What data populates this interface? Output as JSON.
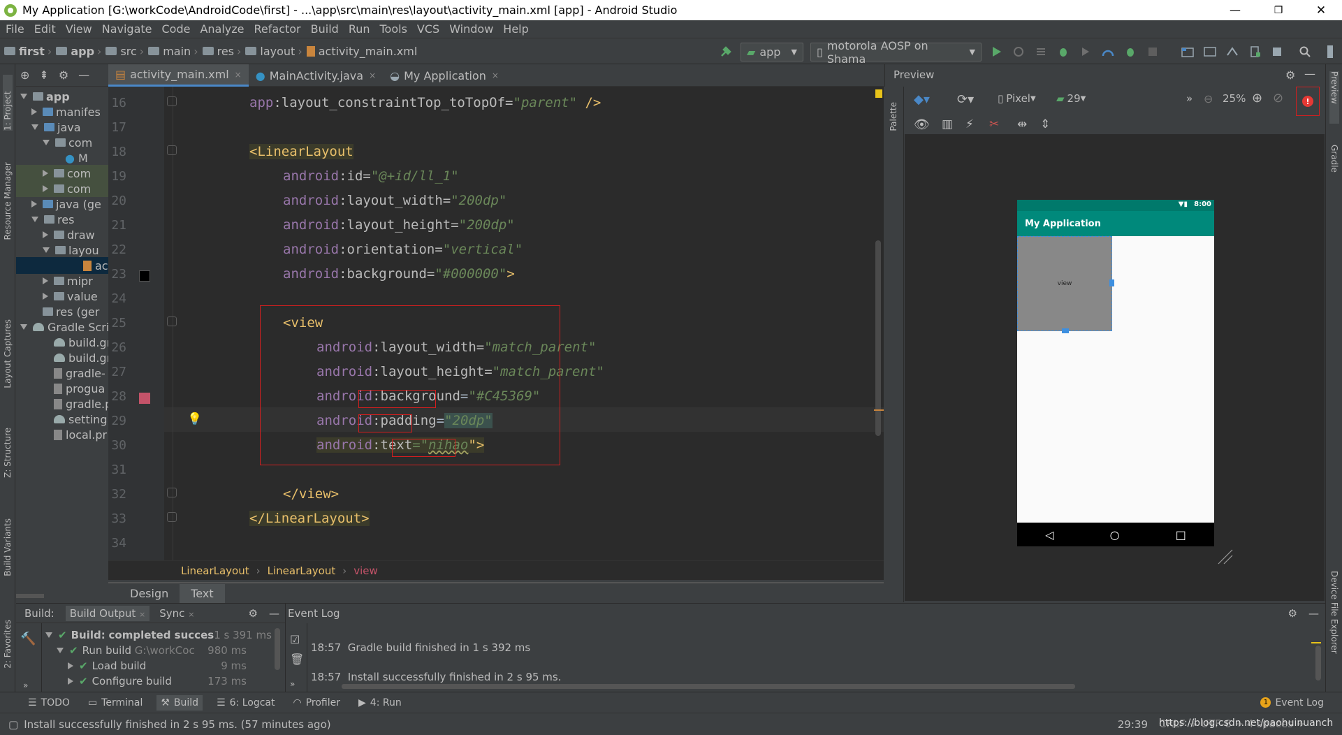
{
  "window": {
    "title": "My Application [G:\\workCode\\AndroidCode\\first] - ...\\app\\src\\main\\res\\layout\\activity_main.xml [app] - Android Studio",
    "minimize": "—",
    "restore": "❐",
    "close": "✕"
  },
  "menu": [
    "File",
    "Edit",
    "View",
    "Navigate",
    "Code",
    "Analyze",
    "Refactor",
    "Build",
    "Run",
    "Tools",
    "VCS",
    "Window",
    "Help"
  ],
  "breadcrumb": {
    "first": "first",
    "app": "app",
    "src": "src",
    "main": "main",
    "res": "res",
    "layout": "layout",
    "file": "activity_main.xml"
  },
  "toolbar": {
    "config": "app",
    "device": "motorola AOSP on Shama"
  },
  "left_stripe": {
    "project": "1: Project",
    "resource_manager": "Resource Manager",
    "layout_captures": "Layout Captures",
    "structure": "Z: Structure",
    "build_variants": "Build Variants",
    "favorites": "2: Favorites"
  },
  "right_stripe": {
    "preview": "Preview",
    "gradle": "Gradle",
    "device_file_explorer": "Device File Explorer"
  },
  "project_tree": [
    "app",
    "manifes",
    "java",
    "com",
    "M",
    "com",
    "com",
    "java (ge",
    "res",
    "draw",
    "layou",
    "ac",
    "mipr",
    "value",
    "res (ger",
    "Gradle Scri",
    "build.gr",
    "build.gr",
    "gradle-",
    "progua",
    "gradle.p",
    "setting:",
    "local.pr"
  ],
  "editor_tabs": [
    {
      "label": "activity_main.xml"
    },
    {
      "label": "MainActivity.java"
    },
    {
      "label": "My Application"
    }
  ],
  "tab_close": "×",
  "line_numbers": [
    "16",
    "17",
    "18",
    "19",
    "20",
    "21",
    "22",
    "23",
    "24",
    "25",
    "26",
    "27",
    "28",
    "29",
    "30",
    "31",
    "32",
    "33",
    "34"
  ],
  "code": {
    "l16_ns": "app",
    "l16_attr": ":layout_constraintTop_toTopOf=",
    "l16_val": "\"parent\"",
    "l16_end": " />",
    "l18_tag": "<LinearLayout",
    "android": "android",
    "l19_attr": ":id=",
    "l19_val": "\"@+id/ll_1\"",
    "l20_attr": ":layout_width=",
    "l20_val": "\"200dp\"",
    "l21_attr": ":layout_height=",
    "l21_val": "\"200dp\"",
    "l22_attr": ":orientation=",
    "l22_val": "\"vertical\"",
    "l23_attr": ":background=",
    "l23_val": "\"#000000\"",
    "l23_end": ">",
    "l25_tag": "<view",
    "l26_attr": ":layout_width=",
    "l26_val": "\"match_parent\"",
    "l27_attr": ":layout_height=",
    "l27_val": "\"match_parent\"",
    "l28_colon": ":",
    "l28_attr": "background",
    "l28_eq": "=",
    "l28_val": "\"#C45369\"",
    "l29_colon": ":",
    "l29_attr": "padding",
    "l29_eq": "=",
    "l29_val": "\"20dp\"",
    "l30_attr": ":text",
    "l30_eq": "=\"",
    "l30_val": "nihao",
    "l30_end": "\">",
    "l32_tag": "</view>",
    "l33_tag": "</LinearLayout>"
  },
  "editor_breadcrumb": [
    "LinearLayout",
    "LinearLayout",
    "view"
  ],
  "editor_breadcrumb_sep": "›",
  "design_tabs": [
    "Design",
    "Text"
  ],
  "preview": {
    "title": "Preview",
    "palette": "Palette",
    "device": "Pixel",
    "api": "29",
    "zoom": "25%",
    "more": "»",
    "status_time": "8:00",
    "app_title": "My Application",
    "view_label": "view",
    "nav_back": "◁",
    "nav_home": "○",
    "nav_recent": "□"
  },
  "build_panel": {
    "header": "Build:",
    "tab_output": "Build Output",
    "tab_sync": "Sync",
    "rows": [
      {
        "label": "Build:",
        "label2": "completed succes",
        "time": "1 s 391 ms"
      },
      {
        "label": "Run build",
        "label2": "G:\\workCoc",
        "time": "980 ms"
      },
      {
        "label": "Load build",
        "label2": "",
        "time": "9 ms"
      },
      {
        "label": "Configure build",
        "label2": "",
        "time": "173 ms"
      }
    ]
  },
  "event_log": {
    "header": "Event Log",
    "entries": [
      {
        "time": "18:57",
        "text": "Gradle build finished in 1 s 392 ms"
      },
      {
        "time": "18:57",
        "text": "Install successfully finished in 2 s 95 ms."
      }
    ]
  },
  "tool_windows": {
    "todo": "TODO",
    "terminal": "Terminal",
    "build": "Build",
    "logcat": "6: Logcat",
    "profiler": "Profiler",
    "run": "4: Run",
    "event_log": "Event Log",
    "event_count": "1"
  },
  "status": {
    "message": "Install successfully finished in 2 s 95 ms. (57 minutes ago)",
    "position": "29:39",
    "encoding": "CRLF ÷  UTF-8 ÷  4 spaces ÷",
    "watermark": "https://blog.csdn.net/paohuinuanchang"
  },
  "colors": {
    "accent": "#4a88c7",
    "teal": "#00897b",
    "red_annotation": "#d21f1f",
    "swatch_black": "#000000",
    "swatch_pink": "#C45369"
  }
}
